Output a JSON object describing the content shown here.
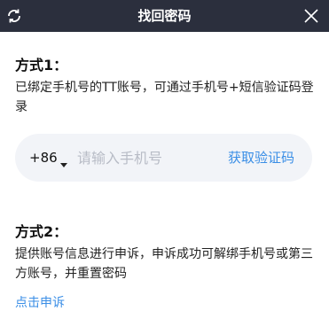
{
  "window": {
    "title": "找回密码",
    "refresh_icon": "refresh-icon",
    "close_icon": "close-icon"
  },
  "method1": {
    "title": "方式1：",
    "description": "已绑定手机号的TT账号，可通过手机号+短信验证码登录"
  },
  "phone": {
    "country_code": "+86",
    "placeholder": "请输入手机号",
    "value": "",
    "get_code_label": "获取验证码"
  },
  "method2": {
    "title": "方式2：",
    "description": "提供账号信息进行申诉，申诉成功可解绑手机号或第三方账号，并重置密码",
    "appeal_link": "点击申诉"
  },
  "colors": {
    "titlebar_bg": "#2b2f3d",
    "accent": "#3a8ee6",
    "input_bg": "#f2f4f8"
  }
}
